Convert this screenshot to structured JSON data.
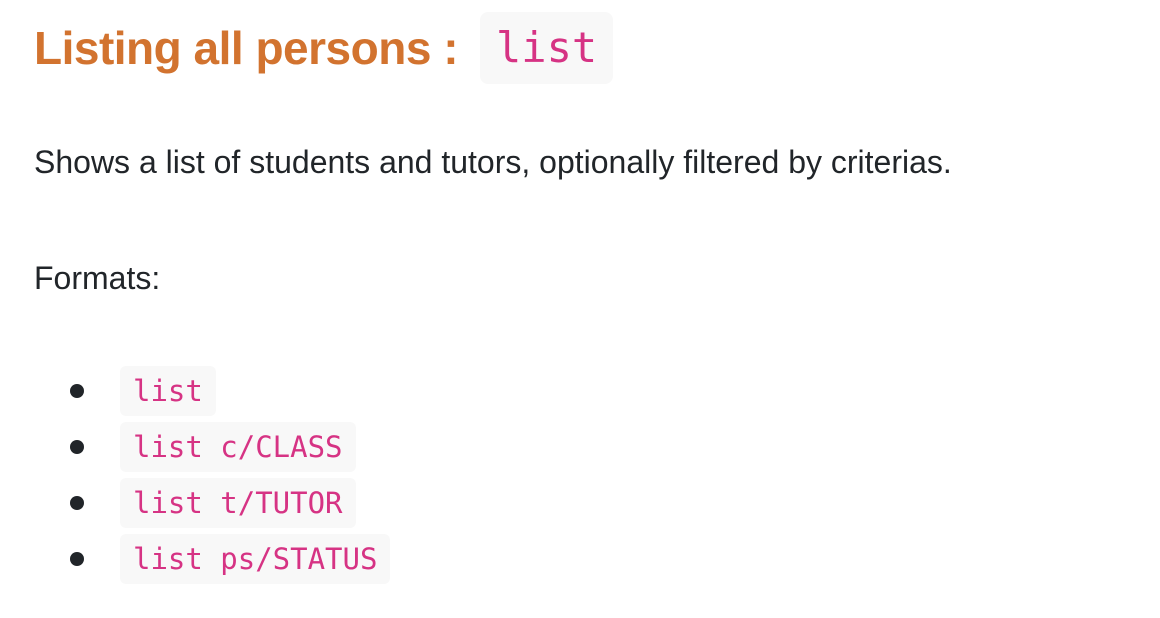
{
  "heading": {
    "text": "Listing all persons :",
    "command": "list"
  },
  "description": "Shows a list of students and tutors, optionally filtered by criterias.",
  "formats_label": "Formats:",
  "formats": [
    "list",
    "list c/CLASS",
    "list t/TUTOR",
    "list ps/STATUS"
  ],
  "colors": {
    "heading": "#d2732f",
    "code_text": "#d63384",
    "code_background": "#f8f8f8",
    "body_text": "#212529"
  }
}
